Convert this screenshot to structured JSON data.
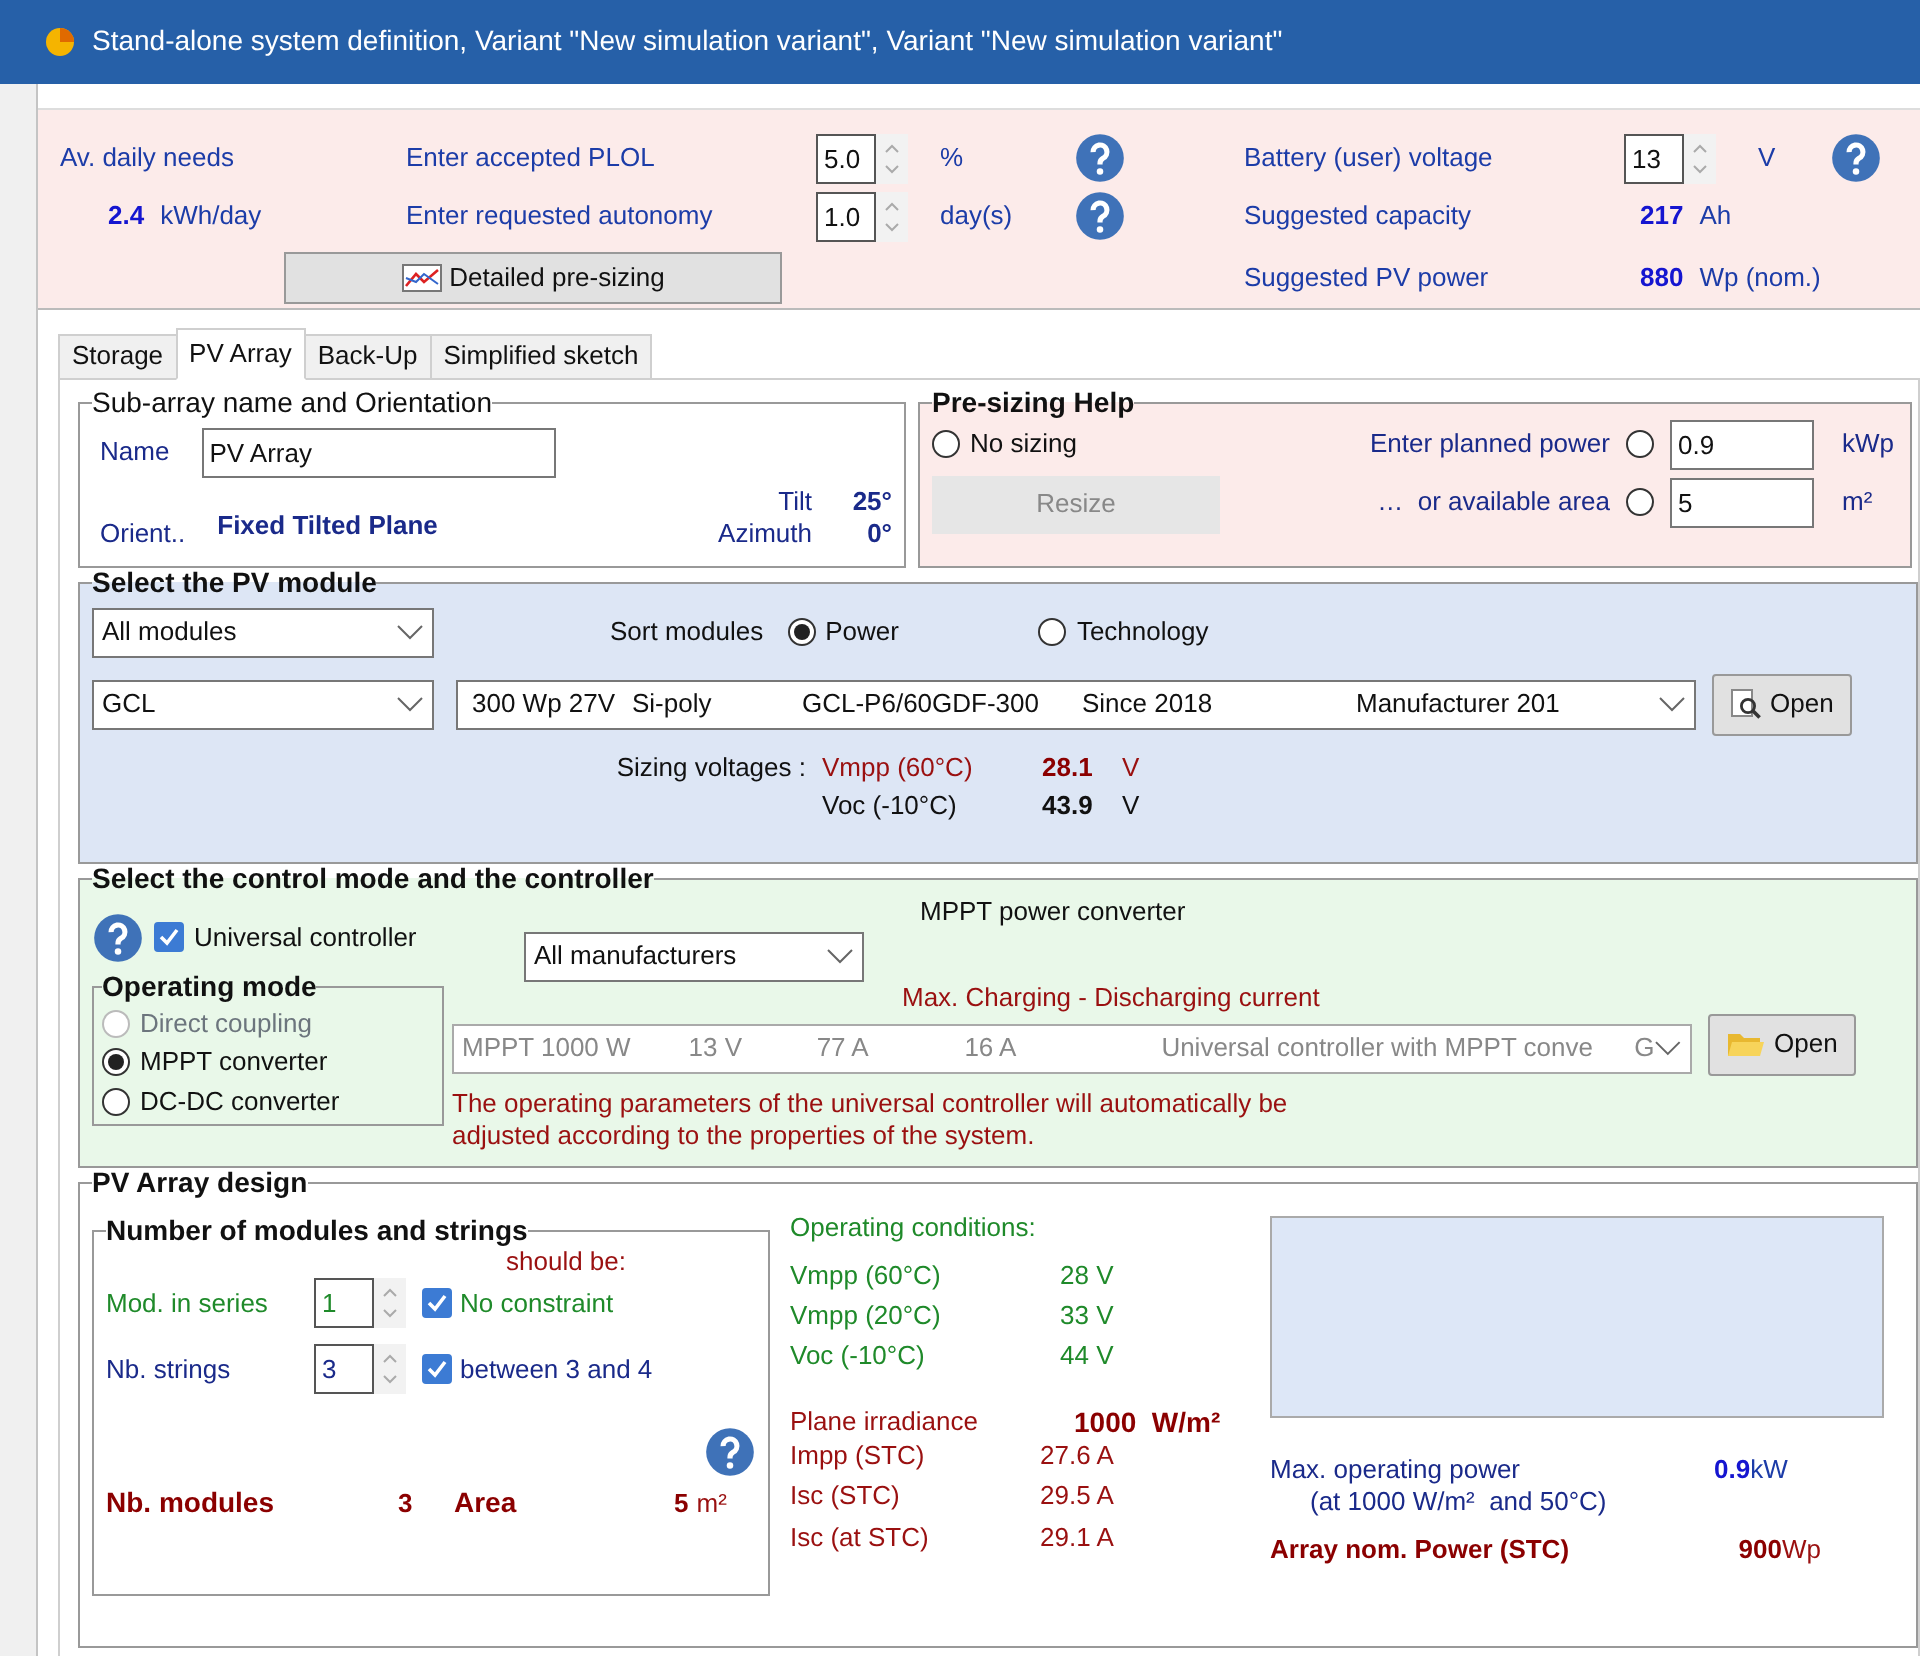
{
  "window": {
    "title": "Stand-alone system definition, Variant \"New simulation variant\", Variant \"New simulation variant\""
  },
  "needs": {
    "label": "Av. daily needs",
    "value": "2.4",
    "unit": "kWh/day"
  },
  "plol": {
    "label": "Enter accepted PLOL",
    "value": "5.0",
    "unit": "%"
  },
  "autonomy": {
    "label": "Enter requested autonomy",
    "value": "1.0",
    "unit": "day(s)"
  },
  "presizing_button": "Detailed pre-sizing",
  "battery": {
    "label": "Battery (user) voltage",
    "value": "13",
    "unit": "V"
  },
  "capacity": {
    "label": "Suggested capacity",
    "value": "217",
    "unit": "Ah"
  },
  "pv_power": {
    "label": "Suggested PV power",
    "value": "880",
    "unit": "Wp (nom.)"
  },
  "tabs": [
    {
      "label": "Storage",
      "selected": false
    },
    {
      "label": "PV Array",
      "selected": true
    },
    {
      "label": "Back-Up",
      "selected": false
    },
    {
      "label": "Simplified sketch",
      "selected": false
    }
  ],
  "sub_array": {
    "legend": "Sub-array name and Orientation",
    "name_label": "Name",
    "name_value": "PV Array",
    "orient_label": "Orient..",
    "orient_value": "Fixed Tilted Plane",
    "tilt_label": "Tilt",
    "tilt_value": "25°",
    "azimuth_label": "Azimuth",
    "azimuth_value": "0°"
  },
  "presizing_help": {
    "legend": "Pre-sizing Help",
    "no_sizing": {
      "label": "No sizing",
      "selected": false
    },
    "resize_button": "Resize",
    "resize_disabled": true,
    "targets": [
      {
        "label": "Enter planned power",
        "selected": false,
        "value": "0.9",
        "unit": "kWp"
      },
      {
        "label": "…  or available area",
        "selected": false,
        "value": "5",
        "unit": "m²"
      }
    ]
  },
  "module": {
    "legend": "Select the PV module",
    "filter": "All modules",
    "sort_label": "Sort modules",
    "sort_options": [
      {
        "label": "Power",
        "selected": true
      },
      {
        "label": "Technology",
        "selected": false
      }
    ],
    "manufacturer": "GCL",
    "model": [
      "300 Wp 27V",
      "Si-poly",
      "GCL-P6/60GDF-300",
      "Since 2018",
      "Manufacturer 201"
    ],
    "open_button": "Open",
    "sizing_label": "Sizing voltages :",
    "voltages": [
      {
        "kind": "vmpp",
        "label": "Vmpp (60°C)",
        "value": "28.1",
        "unit": "V"
      },
      {
        "kind": "voc",
        "label": "Voc (-10°C)",
        "value": "43.9",
        "unit": "V"
      }
    ]
  },
  "controller": {
    "legend": "Select the control mode and the controller",
    "universal": {
      "label": "Universal controller",
      "checked": true
    },
    "manufacturer": "All manufacturers",
    "converter_title": "MPPT power converter",
    "current_title": "Max. Charging - Discharging current",
    "device": [
      "MPPT 1000 W",
      "13 V",
      "77 A",
      "16 A",
      "Universal controller with MPPT conve",
      "G"
    ],
    "device_disabled": true,
    "open_button": "Open",
    "note": "The operating parameters of the universal controller will automatically be adjusted according to the properties of the system.",
    "mode": {
      "legend": "Operating mode",
      "options": [
        {
          "label": "Direct coupling",
          "selected": false,
          "disabled": true
        },
        {
          "label": "MPPT converter",
          "selected": true,
          "disabled": false
        },
        {
          "label": "DC-DC converter",
          "selected": false,
          "disabled": false
        }
      ]
    }
  },
  "design": {
    "legend": "PV Array design",
    "strings": {
      "legend": "Number of modules and strings",
      "hint": "should be:",
      "rows": [
        {
          "kind": "series",
          "label": "Mod. in series",
          "value": "1",
          "check_label": "No constraint",
          "checked": true
        },
        {
          "kind": "strings",
          "label": "Nb. strings",
          "value": "3",
          "check_label": "between 3 and 4",
          "checked": true
        }
      ],
      "modules_label": "Nb. modules",
      "modules_value": "3",
      "area_label": "Area",
      "area_value": "5",
      "area_unit": "m²"
    },
    "conditions_title": "Operating conditions:",
    "conditions": [
      {
        "label": "Vmpp (60°C)",
        "value": "28 V"
      },
      {
        "label": "Vmpp (20°C)",
        "value": "33 V"
      },
      {
        "label": "Voc (-10°C)",
        "value": "44 V"
      }
    ],
    "irradiance": {
      "label": "Plane irradiance",
      "value": "1000  W/m²"
    },
    "currents": [
      {
        "label": "Impp (STC)",
        "value": "27.6 A"
      },
      {
        "label": "Isc (STC)",
        "value": "29.5 A"
      },
      {
        "label": "Isc (at STC)",
        "value": "29.1 A"
      }
    ],
    "max_power": {
      "label": "Max. operating power",
      "value": "0.9",
      "unit": "kW",
      "note": "(at 1000 W/m²  and 50°C)"
    },
    "nom_power": {
      "label": "Array nom. Power (STC)",
      "value": "900",
      "unit": "Wp"
    }
  }
}
